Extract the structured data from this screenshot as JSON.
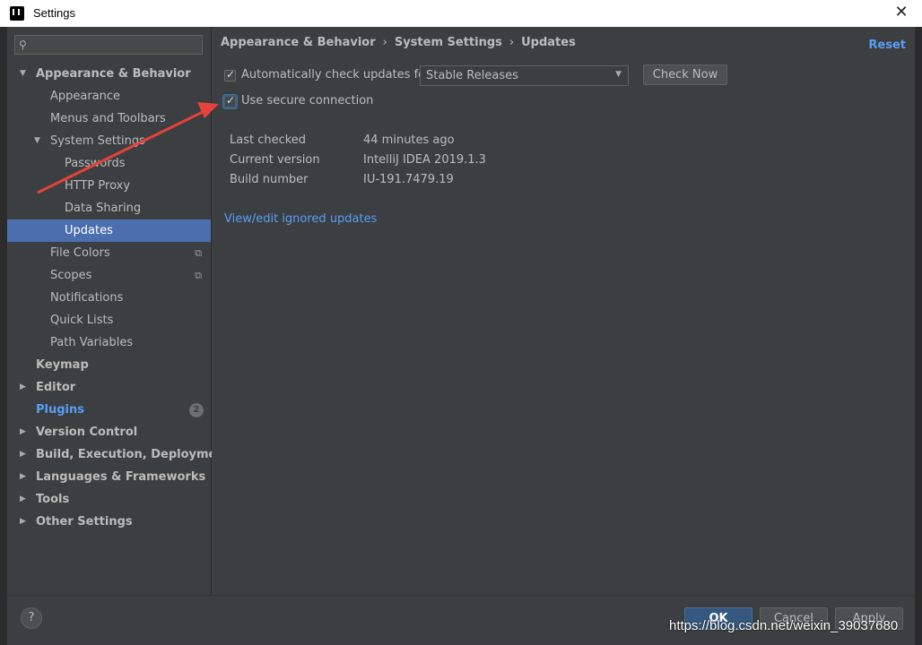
{
  "window": {
    "title": "Settings",
    "close_glyph": "✕"
  },
  "sidebar": {
    "search_placeholder": "",
    "items": [
      {
        "label": "Appearance & Behavior"
      },
      {
        "label": "Appearance"
      },
      {
        "label": "Menus and Toolbars"
      },
      {
        "label": "System Settings"
      },
      {
        "label": "Passwords"
      },
      {
        "label": "HTTP Proxy"
      },
      {
        "label": "Data Sharing"
      },
      {
        "label": "Updates"
      },
      {
        "label": "File Colors"
      },
      {
        "label": "Scopes"
      },
      {
        "label": "Notifications"
      },
      {
        "label": "Quick Lists"
      },
      {
        "label": "Path Variables"
      },
      {
        "label": "Keymap"
      },
      {
        "label": "Editor"
      },
      {
        "label": "Plugins",
        "badge": "2"
      },
      {
        "label": "Version Control"
      },
      {
        "label": "Build, Execution, Deployment"
      },
      {
        "label": "Languages & Frameworks"
      },
      {
        "label": "Tools"
      },
      {
        "label": "Other Settings"
      }
    ]
  },
  "breadcrumb": {
    "part1": "Appearance & Behavior",
    "part2": "System Settings",
    "part3": "Updates",
    "separator": "›"
  },
  "reset_label": "Reset",
  "updates": {
    "auto_check_label": "Automatically check updates for",
    "auto_check_checked": true,
    "channel_value": "Stable Releases",
    "check_now_label": "Check Now",
    "secure_label": "Use secure connection",
    "secure_checked": true,
    "info": [
      {
        "key": "Last checked",
        "value": "44 minutes ago"
      },
      {
        "key": "Current version",
        "value": "IntelliJ IDEA 2019.1.3"
      },
      {
        "key": "Build number",
        "value": "IU-191.7479.19"
      }
    ],
    "ignored_link": "View/edit ignored updates"
  },
  "footer": {
    "help_glyph": "?",
    "ok_label": "OK",
    "cancel_label": "Cancel",
    "apply_label": "Apply"
  },
  "watermark": "https://blog.csdn.net/weixin_39037680",
  "colors": {
    "accent": "#4b6eaf",
    "link": "#589df6",
    "annotation_arrow": "#e8403a"
  }
}
